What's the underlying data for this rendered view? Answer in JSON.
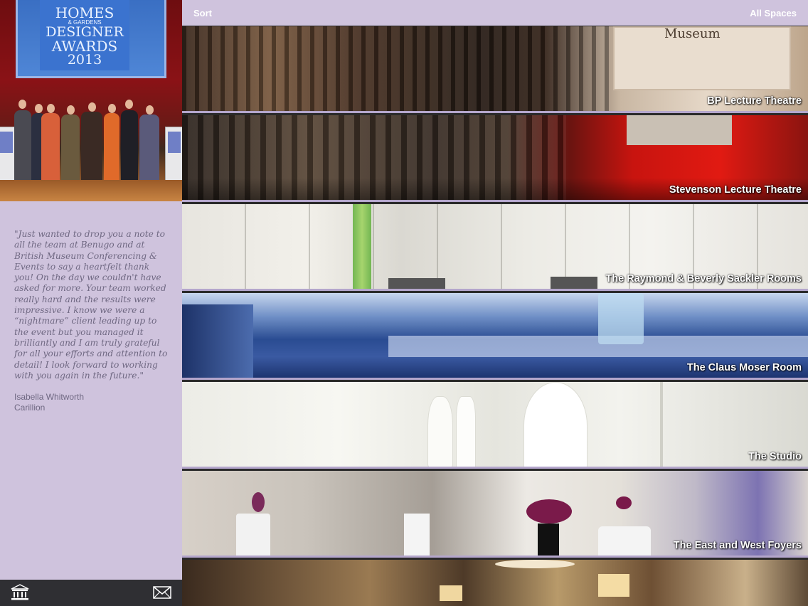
{
  "hero": {
    "award_line1": "HOMES",
    "award_line2": "& GARDENS",
    "award_line3": "DESIGNER",
    "award_line4": "AWARDS",
    "award_year": "2013"
  },
  "testimonial": {
    "quote": "\"Just wanted to drop you a note to all the team at Benugo and at British Museum Conferencing & Events to say a heartfelt thank you! On the day we couldn't have asked for more. Your team worked really hard and the results were impressive. I know we were a “nightmare” client leading up to the event but you managed it brilliantly and I am truly grateful for all your efforts and attention to detail! I look forward to working with you again in the future.\"",
    "author_name": "Isabella Whitworth",
    "author_company": "Carillion"
  },
  "bottombar": {
    "icons": [
      "museum-icon",
      "mail-icon"
    ]
  },
  "topbar": {
    "sort_label": "Sort",
    "filter_label": "All Spaces"
  },
  "rooms": [
    {
      "name": "BP Lecture Theatre",
      "sign_text": "Museum"
    },
    {
      "name": "Stevenson Lecture Theatre"
    },
    {
      "name": "The Raymond & Beverly Sackler Rooms"
    },
    {
      "name": "The Claus Moser Room"
    },
    {
      "name": "The Studio"
    },
    {
      "name": "The East and West Foyers"
    },
    {
      "name": ""
    }
  ],
  "colors": {
    "panel_lavender": "#cfc3dd",
    "divider": "#b4a6cc",
    "bottombar": "#2f2f33",
    "text_muted": "#6f6882"
  }
}
